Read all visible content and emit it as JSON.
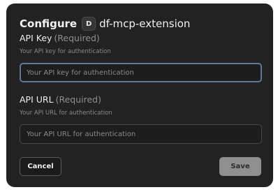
{
  "dialog": {
    "title": "Configure",
    "extension_icon_letter": "D",
    "extension_name": "df-mcp-extension"
  },
  "fields": [
    {
      "label": "API Key",
      "required_text": "(Required)",
      "description": "Your API key for authentication",
      "placeholder": "Your API key for authentication",
      "value": ""
    },
    {
      "label": "API URL",
      "required_text": "(Required)",
      "description": "Your API URL for authentication",
      "placeholder": "Your API URL for authentication",
      "value": ""
    }
  ],
  "buttons": {
    "cancel_label": "Cancel",
    "save_label": "Save"
  },
  "colors": {
    "dialog_background": "#222222",
    "focus_ring": "#5d7a98",
    "save_disabled": "#8f8f8f"
  }
}
